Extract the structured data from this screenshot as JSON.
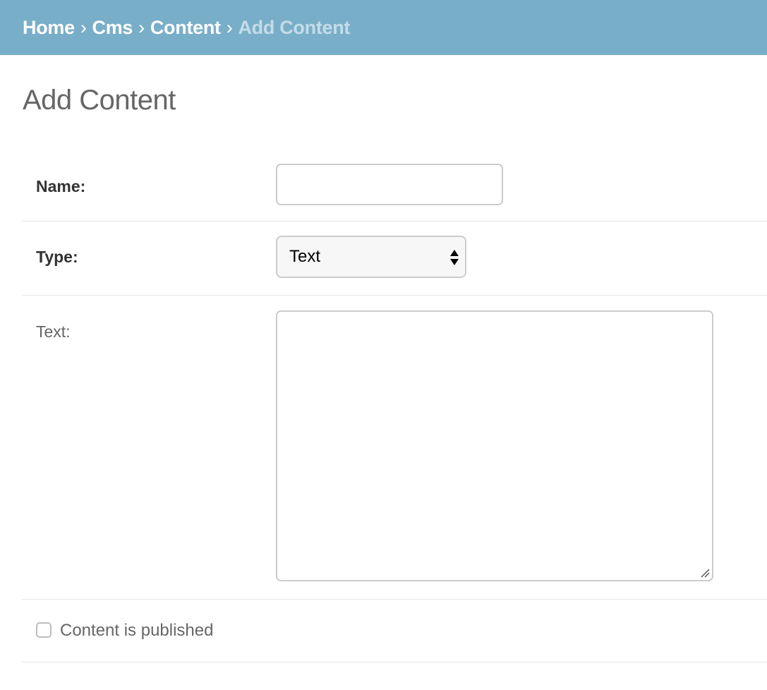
{
  "breadcrumbs": {
    "items": [
      {
        "label": "Home"
      },
      {
        "label": "Cms"
      },
      {
        "label": "Content"
      }
    ],
    "separator": "›",
    "current": "Add Content"
  },
  "page": {
    "title": "Add Content"
  },
  "form": {
    "name": {
      "label": "Name:",
      "value": ""
    },
    "type": {
      "label": "Type:",
      "selected": "Text"
    },
    "text": {
      "label": "Text:",
      "value": ""
    },
    "published": {
      "label": "Content is published",
      "checked": false
    }
  },
  "colors": {
    "header_bg": "#79aec8",
    "breadcrumb_link": "#ffffff",
    "breadcrumb_current": "#c4dce8",
    "title": "#666666",
    "required_label": "#333333",
    "optional_label": "#666666",
    "input_border": "#cccccc",
    "row_divider": "#e6e6e6"
  }
}
